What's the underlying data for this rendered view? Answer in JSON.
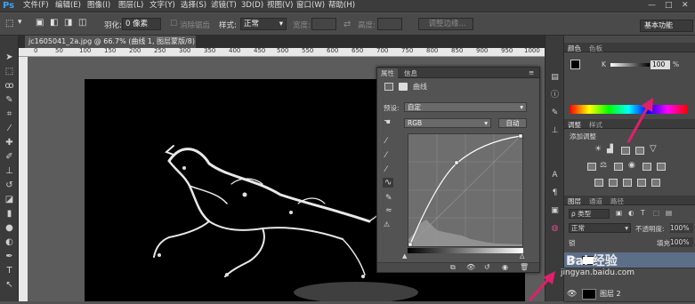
{
  "app": {
    "logo": "Ps"
  },
  "menus": [
    "文件(F)",
    "编辑(E)",
    "图像(I)",
    "图层(L)",
    "文字(Y)",
    "选择(S)",
    "滤镜(T)",
    "3D(D)",
    "视图(V)",
    "窗口(W)",
    "帮助(H)"
  ],
  "window_controls": {
    "minimize": "—",
    "maximize": "□",
    "close": "✕"
  },
  "options": {
    "feather_label": "羽化:",
    "feather_value": "0 像素",
    "antialias": "消除锯齿",
    "style_label": "样式:",
    "style_value": "正常",
    "width_label": "宽度:",
    "height_label": "高度:",
    "refine_button": "调整边缘...",
    "workspace": "基本功能"
  },
  "document": {
    "tab_title": "jc1605041_2a.jpg @ 66.7% (曲线 1, 图层蒙版/8) *",
    "close": "×"
  },
  "ruler": [
    "0",
    "50",
    "100",
    "150",
    "200",
    "250",
    "300",
    "350",
    "400",
    "450",
    "500",
    "550",
    "600",
    "650",
    "700",
    "750",
    "800",
    "850",
    "900",
    "950",
    "1000"
  ],
  "properties": {
    "tab_properties": "属性",
    "tab_info": "信息",
    "title": "曲线",
    "preset_label": "预设:",
    "preset_value": "自定",
    "channel_value": "RGB",
    "auto_button": "自动"
  },
  "color_panel": {
    "tab_color": "颜色",
    "tab_swatches": "色板",
    "channel_label": "K",
    "value": "100",
    "unit": "%"
  },
  "adjustments": {
    "tab_adjustments": "调整",
    "tab_styles": "样式",
    "title": "添加调整"
  },
  "layers": {
    "tab_layers": "图层",
    "tab_channels": "通道",
    "tab_paths": "路径",
    "kind_label": "ρ 类型",
    "blend_mode": "正常",
    "opacity_label": "不透明度:",
    "opacity_value": "100%",
    "lock_label": "锁",
    "fill_label": "填充:",
    "fill_value": "100%",
    "layer_2_name": "图层 2"
  },
  "watermark": {
    "text": "Bai 经验",
    "url": "jingyan.baidu.com"
  },
  "colors": {
    "accent": "#3fa2f0",
    "arrow": "#e0206a"
  }
}
